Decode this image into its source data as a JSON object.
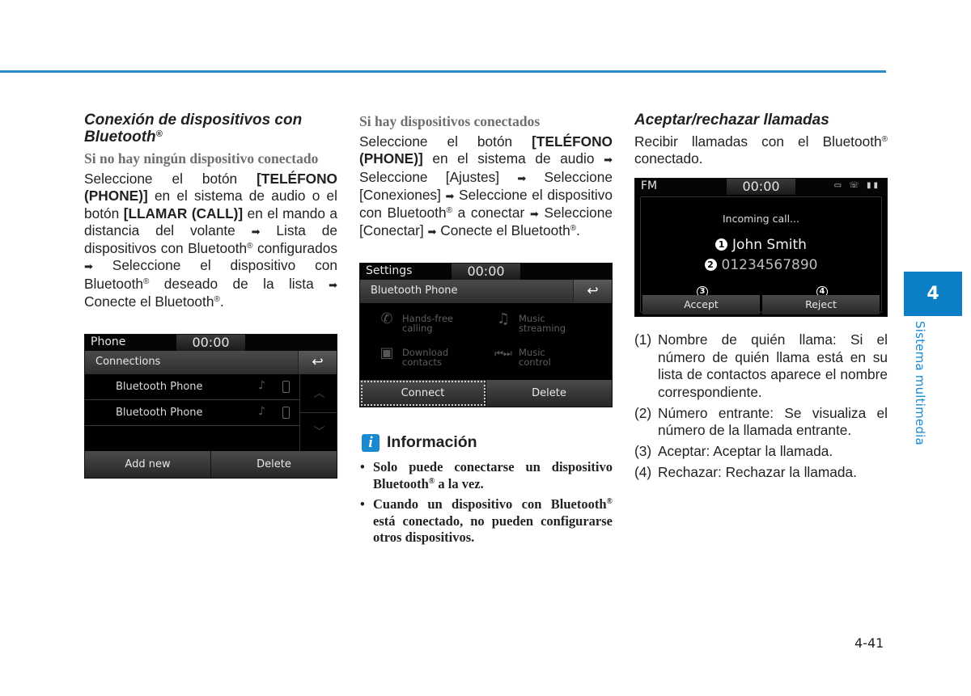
{
  "colors": {
    "accent": "#0c7ec6",
    "rule": "#2b8ccb",
    "subhead_gray": "#6d6e70"
  },
  "col1": {
    "heading": "Conexión de dispositivos con Bluetooth",
    "heading_reg": "®",
    "subheading": "Si no hay ningún dispositivo conectado",
    "p1_a": "Seleccione el botón ",
    "p1_b": "[TELÉFONO (PHONE)]",
    "p1_c": " en el sistema de audio o el botón ",
    "p1_d": "[LLAMAR (CALL)]",
    "p1_e": " en el mando a distancia del volante ",
    "p1_f": " Lista de dispositivos con Bluetooth",
    "p1_g": " configurados ",
    "p1_h": " Seleccione el dispositivo con Bluetooth",
    "p1_i": " deseado de la lista ",
    "p1_j": " Conecte el Bluetooth",
    "p1_k": "."
  },
  "phone_screen": {
    "status_label": "Phone",
    "clock": "00:00",
    "title": "Connections",
    "back_icon": "↩",
    "devices": [
      {
        "name": "Bluetooth Phone"
      },
      {
        "name": "Bluetooth Phone"
      }
    ],
    "scroll_up": "︿",
    "scroll_down": "﹀",
    "buttons": {
      "add_new": "Add new",
      "delete": "Delete"
    }
  },
  "col2": {
    "subheading": "Si hay dispositivos conectados",
    "p1_a": "Seleccione el botón ",
    "p1_b": "[TELÉFONO (PHONE)]",
    "p1_c": " en el sistema de audio ",
    "p1_d": " Seleccione [Ajustes] ",
    "p1_e": " Seleccione [Conexiones] ",
    "p1_f": " Seleccione el dispositivo con Bluetooth",
    "p1_g": " a conectar ",
    "p1_h": " Seleccione [Conectar] ",
    "p1_i": " Conecte el Bluetooth",
    "p1_j": "."
  },
  "settings_screen": {
    "status_label": "Settings",
    "clock": "00:00",
    "title": "Bluetooth Phone",
    "features": [
      {
        "line1": "Hands-free",
        "line2": "calling"
      },
      {
        "line1": "Music",
        "line2": "streaming"
      },
      {
        "line1": "Download",
        "line2": "contacts"
      },
      {
        "line1": "Music",
        "line2": "control"
      }
    ],
    "buttons": {
      "connect": "Connect",
      "delete": "Delete"
    }
  },
  "info": {
    "icon": "i",
    "title": "Información",
    "bullets": [
      {
        "a": "Solo puede conectarse un dispositivo Bluetooth",
        "b": " a la vez."
      },
      {
        "a": "Cuando un dispositivo con Bluetooth",
        "b": " está conectado, no pueden configurarse otros dispositivos."
      }
    ]
  },
  "col3": {
    "heading": "Aceptar/rechazar llamadas",
    "intro_a": "Recibir llamadas con el Bluetooth",
    "intro_b": " conectado."
  },
  "call_screen": {
    "status_label": "FM",
    "clock": "00:00",
    "status_icons": "▭ ☏ ▮▮",
    "incoming": "Incoming call...",
    "caller_name": "John Smith",
    "caller_number": "01234567890",
    "markers": [
      "1",
      "2",
      "3",
      "4"
    ],
    "buttons": {
      "accept": "Accept",
      "reject": "Reject"
    }
  },
  "legend": [
    {
      "n": "(1)",
      "text": "Nombre de quién llama: Si el número de quién llama está en su lista de contactos aparece el nombre correspondiente."
    },
    {
      "n": "(2)",
      "text": "Número entrante: Se visualiza el número de la llamada entrante."
    },
    {
      "n": "(3)",
      "text": "Aceptar: Aceptar la llamada."
    },
    {
      "n": "(4)",
      "text": "Rechazar: Rechazar la llamada."
    }
  ],
  "symbols": {
    "arrow": "➡",
    "reg": "®"
  },
  "side_tab": {
    "chapter": "4",
    "label": "Sistema multimedia"
  },
  "page_number": "4-41"
}
